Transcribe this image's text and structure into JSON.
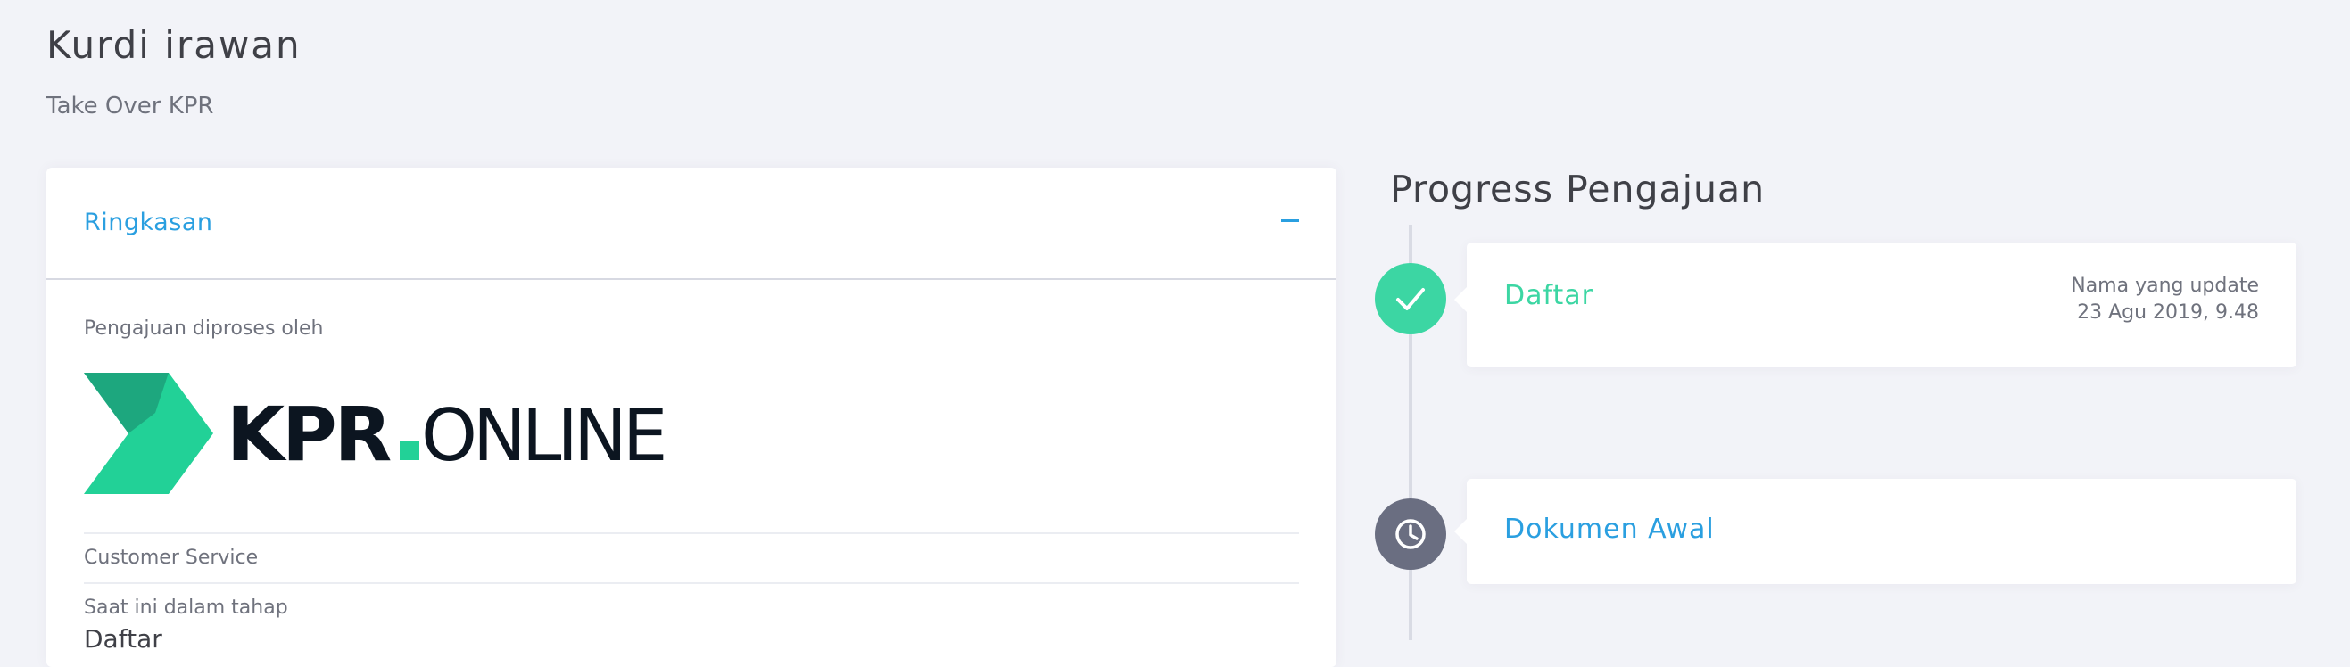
{
  "header": {
    "title": "Kurdi irawan",
    "subtitle": "Take Over KPR"
  },
  "summary": {
    "title": "Ringkasan",
    "processed_by_label": "Pengajuan diproses oleh",
    "logo_text": "KPR.ONLINE",
    "customer_service_label": "Customer Service",
    "current_stage_label": "Saat ini dalam tahap",
    "current_stage_value": "Daftar"
  },
  "progress": {
    "title": "Progress Pengajuan",
    "steps": [
      {
        "name": "Daftar",
        "status": "done",
        "icon": "check-icon",
        "updated_by": "Nama yang update",
        "updated_at": "23 Agu 2019, 9.48"
      },
      {
        "name": "Dokumen Awal",
        "status": "pending",
        "icon": "clock-icon"
      }
    ]
  },
  "colors": {
    "accent_blue": "#2a9fe0",
    "success_green": "#3cd6a3",
    "pending_gray": "#6a6e81",
    "logo_dark": "#0c1520",
    "logo_green": "#22d197"
  }
}
